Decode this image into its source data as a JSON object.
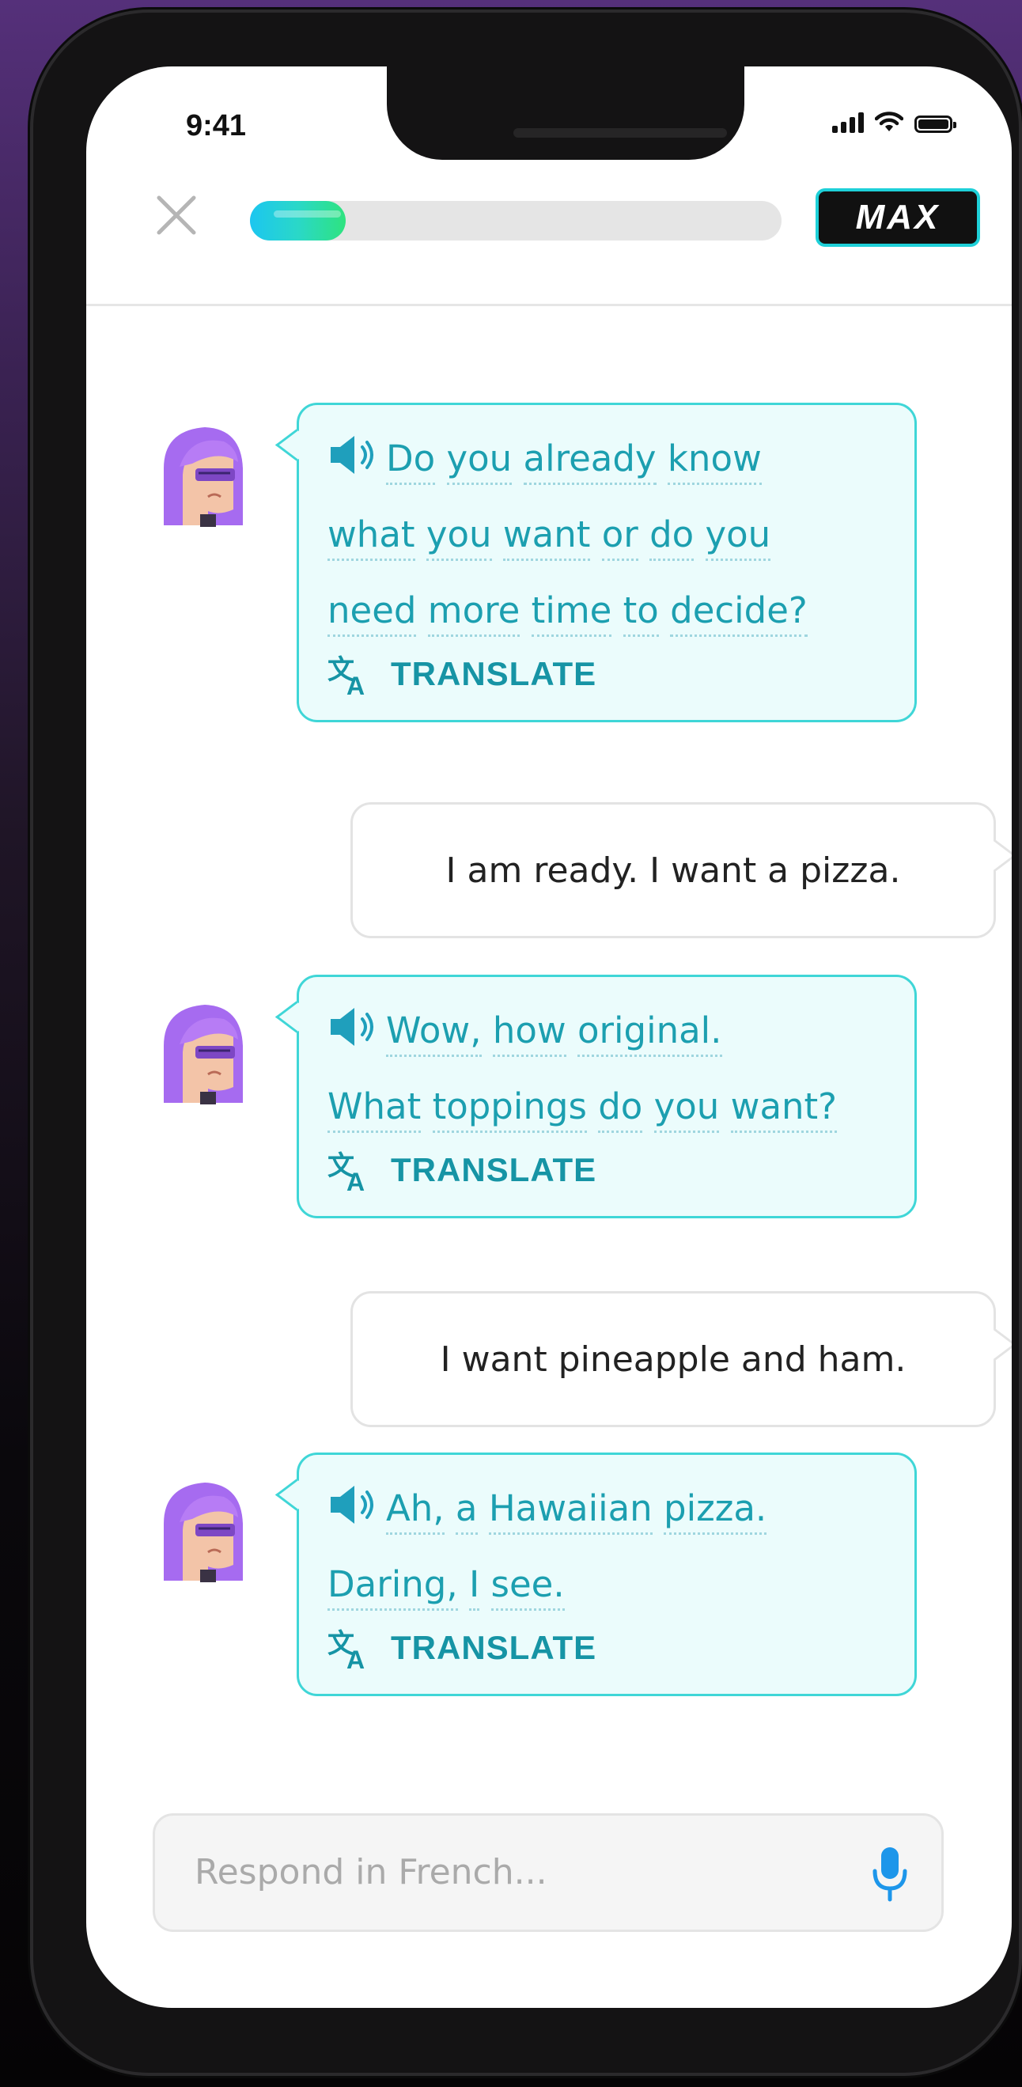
{
  "status_bar": {
    "time": "9:41"
  },
  "header": {
    "badge": "MAX",
    "progress_fraction": 0.18
  },
  "messages": [
    {
      "speaker": "ai",
      "lines": [
        [
          "Do",
          "you",
          "already",
          "know"
        ],
        [
          "what",
          "you",
          "want",
          "or",
          "do",
          "you"
        ],
        [
          "need",
          "more",
          "time",
          "to",
          "decide?"
        ]
      ],
      "translate_label": "TRANSLATE"
    },
    {
      "speaker": "user",
      "text": "I am ready. I want a pizza."
    },
    {
      "speaker": "ai",
      "lines": [
        [
          "Wow,",
          "how",
          "original."
        ],
        [
          "What",
          "toppings",
          "do",
          "you",
          "want?"
        ]
      ],
      "translate_label": "TRANSLATE"
    },
    {
      "speaker": "user",
      "text": "I want pineapple and ham."
    },
    {
      "speaker": "ai",
      "lines": [
        [
          "Ah,",
          "a",
          "Hawaiian",
          "pizza."
        ],
        [
          "Daring,",
          "I",
          "see."
        ]
      ],
      "translate_label": "TRANSLATE"
    }
  ],
  "input": {
    "placeholder": "Respond in French..."
  },
  "colors": {
    "accent": "#3fd6d7",
    "ai_text": "#1c9fb0",
    "avatar": "#a66bf0"
  },
  "icons": [
    "close-icon",
    "speaker-icon",
    "translate-icon",
    "microphone-icon",
    "signal-icon",
    "wifi-icon",
    "battery-icon"
  ]
}
